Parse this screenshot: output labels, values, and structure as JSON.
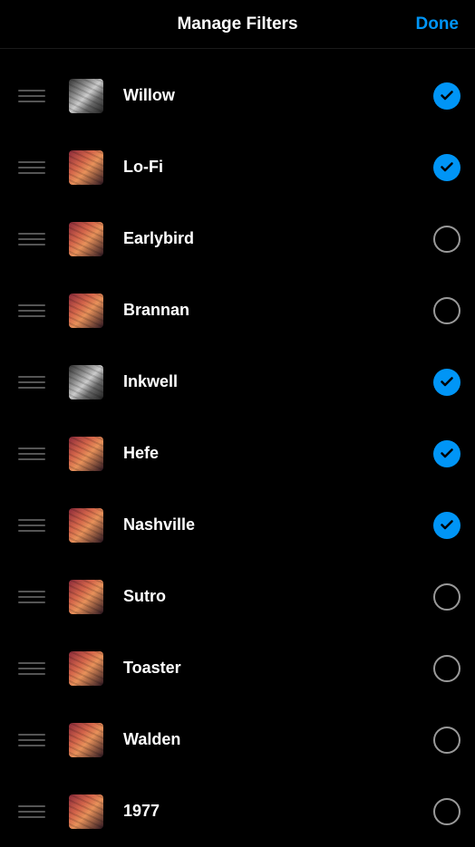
{
  "header": {
    "title": "Manage Filters",
    "done_label": "Done"
  },
  "filters": [
    {
      "name": "Willow",
      "enabled": true,
      "thumb_style": "grayscale"
    },
    {
      "name": "Lo-Fi",
      "enabled": true,
      "thumb_style": "color"
    },
    {
      "name": "Earlybird",
      "enabled": false,
      "thumb_style": "color"
    },
    {
      "name": "Brannan",
      "enabled": false,
      "thumb_style": "color"
    },
    {
      "name": "Inkwell",
      "enabled": true,
      "thumb_style": "grayscale"
    },
    {
      "name": "Hefe",
      "enabled": true,
      "thumb_style": "color"
    },
    {
      "name": "Nashville",
      "enabled": true,
      "thumb_style": "color"
    },
    {
      "name": "Sutro",
      "enabled": false,
      "thumb_style": "color"
    },
    {
      "name": "Toaster",
      "enabled": false,
      "thumb_style": "color"
    },
    {
      "name": "Walden",
      "enabled": false,
      "thumb_style": "color"
    },
    {
      "name": "1977",
      "enabled": false,
      "thumb_style": "color"
    }
  ],
  "colors": {
    "accent": "#0095f6",
    "background": "#000000",
    "text": "#ffffff"
  }
}
